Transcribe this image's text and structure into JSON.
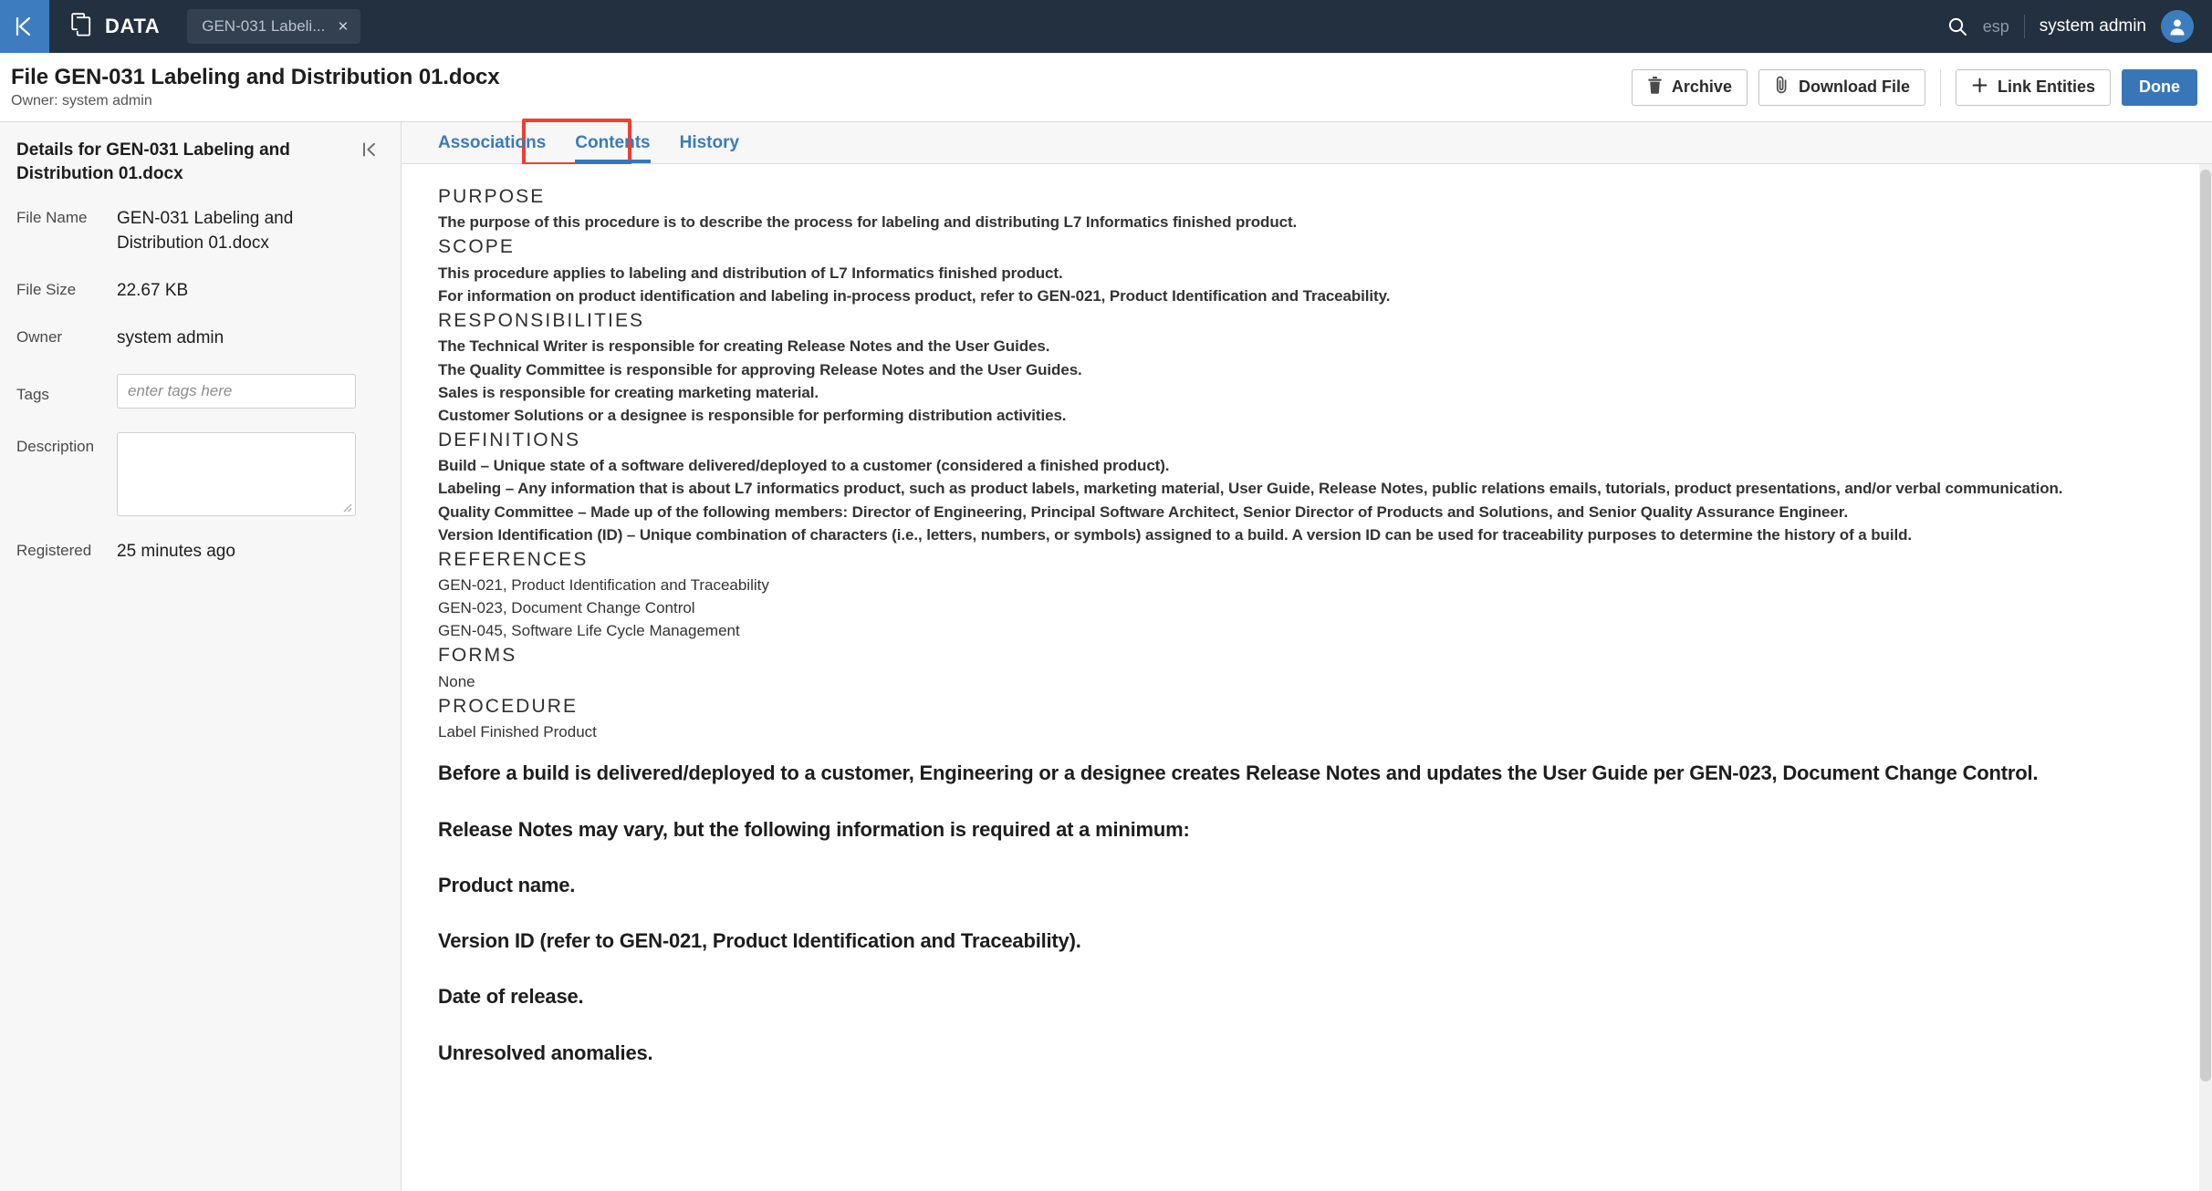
{
  "topbar": {
    "back_icon": "chevron-double-left-icon",
    "module_icon": "documents-icon",
    "module_label": "DATA",
    "open_tab": {
      "label": "GEN-031 Labeli...",
      "close": "×"
    },
    "search_icon": "search-icon",
    "locale": "esp",
    "username": "system admin",
    "avatar_icon": "user-avatar-icon"
  },
  "pagehead": {
    "title": "File GEN-031 Labeling and Distribution 01.docx",
    "subtitle": "Owner: system admin",
    "actions": {
      "archive": "Archive",
      "download": "Download File",
      "link_entities": "Link Entities",
      "done": "Done"
    }
  },
  "sidebar": {
    "title": "Details for GEN-031 Labeling and Distribution 01.docx",
    "collapse_icon": "collapse-panel-icon",
    "fields": {
      "file_name_label": "File Name",
      "file_name_value": "GEN-031 Labeling and Distribution 01.docx",
      "file_size_label": "File Size",
      "file_size_value": "22.67 KB",
      "owner_label": "Owner",
      "owner_value": "system admin",
      "tags_label": "Tags",
      "tags_placeholder": "enter tags here",
      "tags_value": "",
      "description_label": "Description",
      "description_value": "",
      "registered_label": "Registered",
      "registered_value": "25 minutes ago"
    }
  },
  "tabs": [
    {
      "label": "Associations",
      "active": false
    },
    {
      "label": "Contents",
      "active": true
    },
    {
      "label": "History",
      "active": false
    }
  ],
  "document": {
    "blocks": [
      {
        "style": "heading",
        "text": "PURPOSE"
      },
      {
        "style": "small",
        "text": "The purpose of this procedure is to describe the process for labeling and distributing L7 Informatics finished product."
      },
      {
        "style": "heading",
        "text": "SCOPE"
      },
      {
        "style": "small",
        "text": "This procedure applies to labeling and distribution of L7 Informatics finished product."
      },
      {
        "style": "small",
        "text": "For information on product identification and labeling in-process product, refer to GEN-021, Product Identification and Traceability."
      },
      {
        "style": "heading",
        "text": "RESPONSIBILITIES"
      },
      {
        "style": "small",
        "text": "The Technical Writer is responsible for creating Release Notes and the User Guides."
      },
      {
        "style": "small",
        "text": "The Quality Committee is responsible for approving Release Notes and the User Guides."
      },
      {
        "style": "small",
        "text": "Sales is responsible for creating marketing material."
      },
      {
        "style": "small",
        "text": "Customer Solutions or a designee is responsible for performing distribution activities."
      },
      {
        "style": "heading",
        "text": "DEFINITIONS"
      },
      {
        "style": "small",
        "text": "Build – Unique state of a software delivered/deployed to a customer (considered a finished product)."
      },
      {
        "style": "small",
        "text": "Labeling – Any information that is about L7 informatics product, such as product labels, marketing material, User Guide, Release Notes, public relations emails, tutorials, product presentations, and/or verbal communication."
      },
      {
        "style": "small",
        "text": "Quality Committee – Made up of the following members: Director of Engineering, Principal Software Architect, Senior Director of Products and Solutions, and Senior Quality Assurance Engineer."
      },
      {
        "style": "small",
        "text": "Version Identification (ID) – Unique combination of characters (i.e., letters, numbers, or symbols) assigned to a build. A version ID can be used for traceability purposes to determine the history of a build."
      },
      {
        "style": "heading",
        "text": "REFERENCES"
      },
      {
        "style": "plain",
        "text": "GEN-021, Product Identification and Traceability"
      },
      {
        "style": "plain",
        "text": "GEN-023, Document Change Control"
      },
      {
        "style": "plain",
        "text": "GEN-045, Software Life Cycle Management"
      },
      {
        "style": "heading",
        "text": "FORMS"
      },
      {
        "style": "plain",
        "text": "None"
      },
      {
        "style": "heading",
        "text": "PROCEDURE"
      },
      {
        "style": "plain",
        "text": "Label Finished Product"
      },
      {
        "style": "gap",
        "text": ""
      },
      {
        "style": "large",
        "text": "Before a build is delivered/deployed to a customer, Engineering or a designee creates Release Notes and updates the User Guide per GEN-023, Document Change Control."
      },
      {
        "style": "large",
        "text": "Release Notes may vary, but the following information is required at a minimum:"
      },
      {
        "style": "large",
        "text": "Product name."
      },
      {
        "style": "large",
        "text": "Version ID (refer to GEN-021, Product Identification and Traceability)."
      },
      {
        "style": "large",
        "text": "Date of release."
      },
      {
        "style": "large",
        "text": "Unresolved anomalies."
      }
    ]
  },
  "colors": {
    "topbar_bg": "#22303f",
    "accent_blue": "#3876b8",
    "back_blue": "#3d7dbf",
    "highlight_red": "#f03e2f",
    "sidebar_bg": "#f7f7f7"
  }
}
